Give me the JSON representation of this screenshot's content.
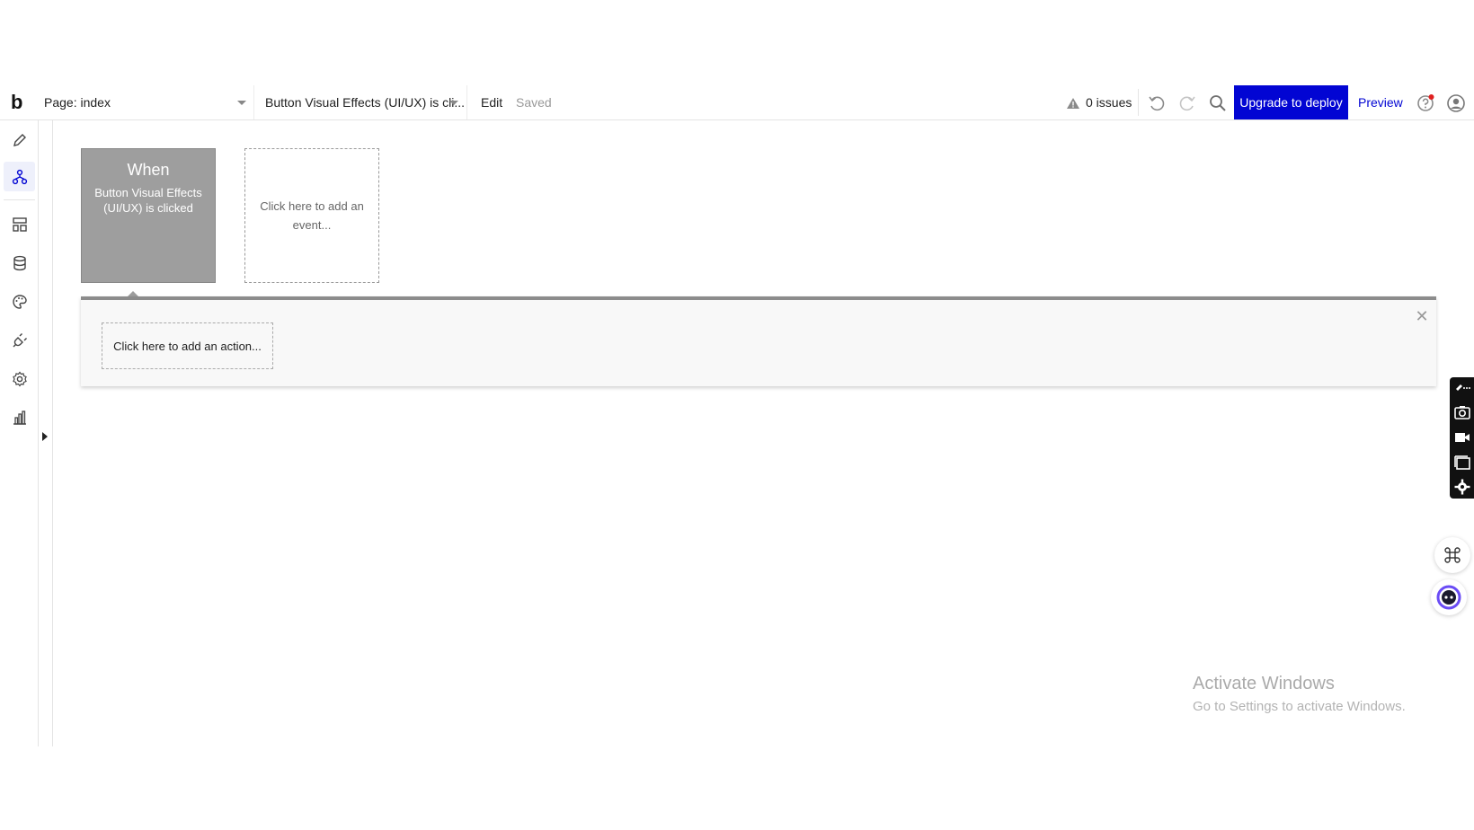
{
  "toolbar": {
    "logo": "b",
    "page_select": "Page: index",
    "event_select": "Button Visual Effects (UI/UX) is cli...",
    "edit_label": "Edit",
    "saved_label": "Saved",
    "issues_label": "0 issues",
    "upgrade_label": "Upgrade to deploy",
    "preview_label": "Preview",
    "icons": [
      "warning-icon",
      "undo-icon",
      "redo-icon",
      "search-icon",
      "help-icon",
      "account-icon"
    ],
    "accent_color": "#0205d3"
  },
  "sidebar": {
    "items": [
      {
        "name": "design",
        "icon": "pencil-icon"
      },
      {
        "name": "workflow",
        "icon": "workflow-icon",
        "active": true
      },
      {
        "name": "reusable",
        "icon": "layout-icon"
      },
      {
        "name": "data",
        "icon": "database-icon"
      },
      {
        "name": "styles",
        "icon": "palette-icon"
      },
      {
        "name": "plugins",
        "icon": "plug-icon"
      },
      {
        "name": "settings",
        "icon": "gear-icon"
      },
      {
        "name": "logs",
        "icon": "bar-chart-icon"
      }
    ]
  },
  "workflow": {
    "when_title": "When",
    "when_desc": "Button Visual Effects (UI/UX) is clicked",
    "add_event_label": "Click here to add an event...",
    "add_action_label": "Click here to add an action..."
  },
  "watermark": {
    "title": "Activate Windows",
    "subtitle": "Go to Settings to activate Windows."
  }
}
